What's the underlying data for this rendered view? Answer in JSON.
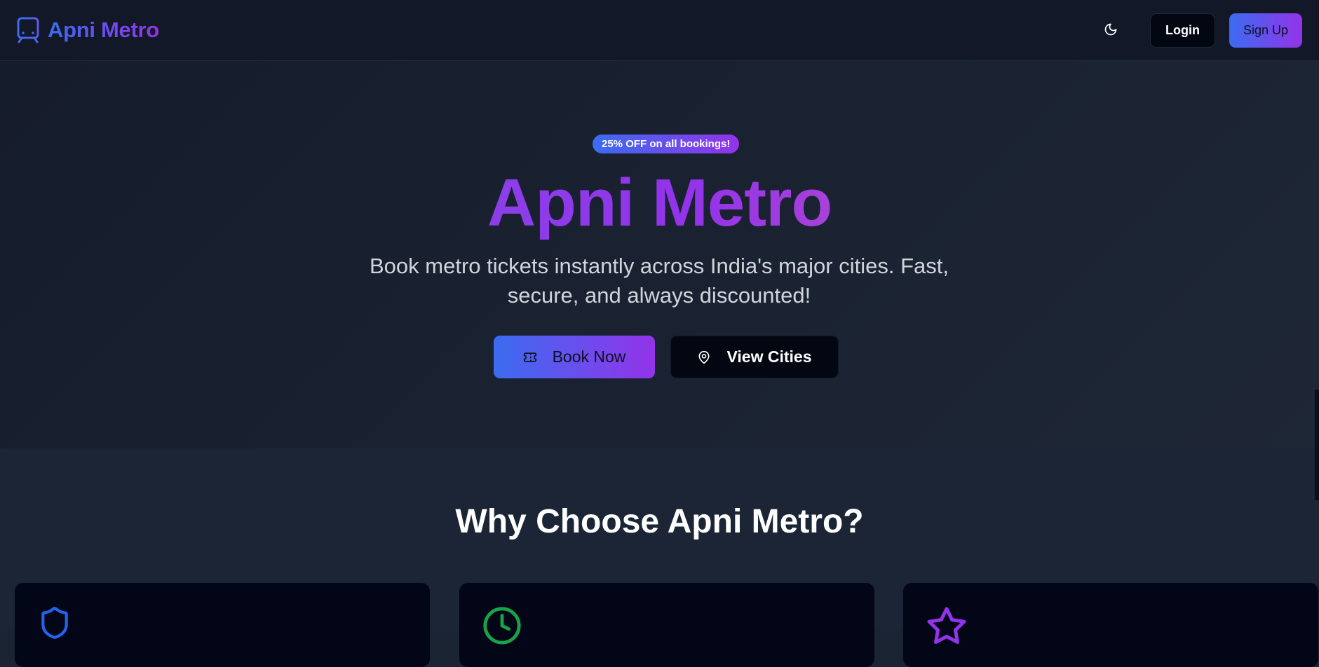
{
  "header": {
    "brand": "Apni Metro",
    "login_label": "Login",
    "signup_label": "Sign Up"
  },
  "hero": {
    "badge": "25% OFF on all bookings!",
    "title": "Apni Metro",
    "subtitle": "Book metro tickets instantly across India's major cities. Fast, secure, and always discounted!",
    "book_label": "Book Now",
    "cities_label": "View Cities"
  },
  "features": {
    "title": "Why Choose Apni Metro?",
    "cards": [
      {
        "icon": "shield-icon",
        "color": "#2563eb"
      },
      {
        "icon": "clock-icon",
        "color": "#16a34a"
      },
      {
        "icon": "star-icon",
        "color": "#9333ea"
      }
    ]
  },
  "colors": {
    "accent_blue": "#3b6cf0",
    "accent_purple": "#9333ea",
    "background": "#1b2433",
    "header_bg": "#121827"
  }
}
